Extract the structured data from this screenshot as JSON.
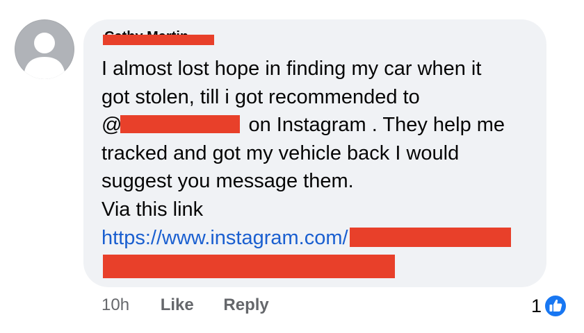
{
  "comment": {
    "author_name": "Cathy Martin",
    "body": {
      "line1": "I almost lost hope in finding my car when it",
      "line2": "got stolen, till i got recommended to",
      "line3_prefix": "@",
      "line3_suffix": "on Instagram . They  help me",
      "line4": "tracked and got my vehicle back I would",
      "line5": "suggest you message them.",
      "line6": "Via this link",
      "link_url": "https://www.instagram.com/"
    },
    "timestamp": "10h",
    "like_label": "Like",
    "reply_label": "Reply",
    "reaction_count": "1"
  },
  "icons": {
    "avatar": "default-user-avatar-icon",
    "reaction": "thumbs-up-like-icon"
  },
  "colors": {
    "bubble": "#f0f2f5",
    "link": "#1a5fd0",
    "redaction": "#e8402a",
    "meta_text": "#65676b",
    "like_blue": "#1877f2"
  }
}
